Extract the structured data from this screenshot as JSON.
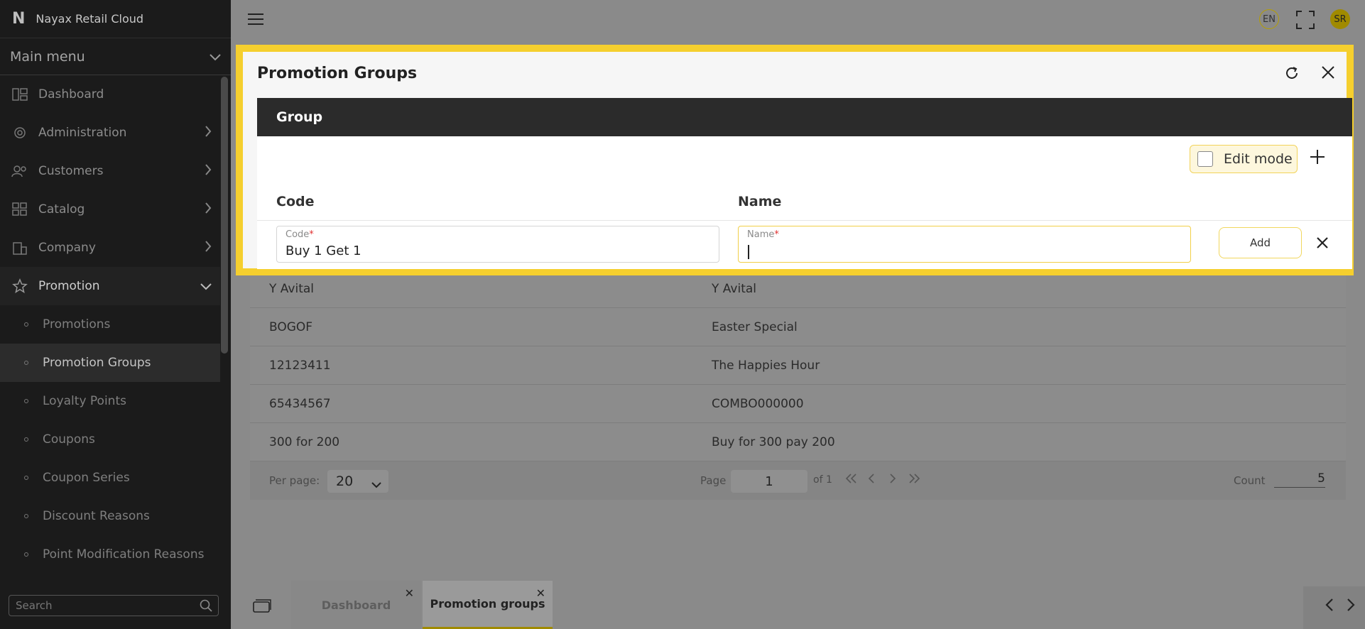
{
  "app": {
    "logo": "N",
    "title": "Nayax Retail Cloud"
  },
  "sidebar": {
    "main_menu": "Main menu",
    "items": [
      {
        "label": "Dashboard",
        "icon": "dashboard-icon"
      },
      {
        "label": "Administration",
        "icon": "admin-gear-icon"
      },
      {
        "label": "Customers",
        "icon": "users-icon"
      },
      {
        "label": "Catalog",
        "icon": "catalog-grid-icon"
      },
      {
        "label": "Company",
        "icon": "building-icon"
      },
      {
        "label": "Promotion",
        "icon": "star-icon"
      }
    ],
    "sub_items": [
      "Promotions",
      "Promotion Groups",
      "Loyalty Points",
      "Coupons",
      "Coupon Series",
      "Discount Reasons",
      "Point Modification Reasons"
    ],
    "search_placeholder": "Search"
  },
  "topbar": {
    "lang": "EN",
    "avatar": "SR"
  },
  "modal": {
    "title": "Promotion Groups",
    "section": "Group",
    "edit_mode_label": "Edit mode",
    "col_code": "Code",
    "col_name": "Name",
    "code_field_label": "Code",
    "code_field_value": "Buy 1 Get 1",
    "name_field_label": "Name",
    "name_field_value": "",
    "required_mark": "*",
    "add_label": "Add"
  },
  "table": {
    "rows": [
      {
        "code": "Y Avital",
        "name": "Y Avital"
      },
      {
        "code": "BOGOF",
        "name": "Easter Special"
      },
      {
        "code": "12123411",
        "name": "The Happies Hour"
      },
      {
        "code": "65434567",
        "name": "COMBO000000"
      },
      {
        "code": "300 for 200",
        "name": "Buy for 300 pay 200"
      }
    ]
  },
  "pager": {
    "per_page_label": "Per page:",
    "per_page_value": "20",
    "page_label": "Page",
    "page_value": "1",
    "of_label": "of 1",
    "count_label": "Count",
    "count_value": "5"
  },
  "tabs": [
    {
      "label": "Dashboard"
    },
    {
      "label": "Promotion groups"
    }
  ],
  "colors": {
    "accent": "#f5cf2e",
    "sidebar_bg": "#1b1b1b",
    "header_dark": "#2b2b2b"
  }
}
